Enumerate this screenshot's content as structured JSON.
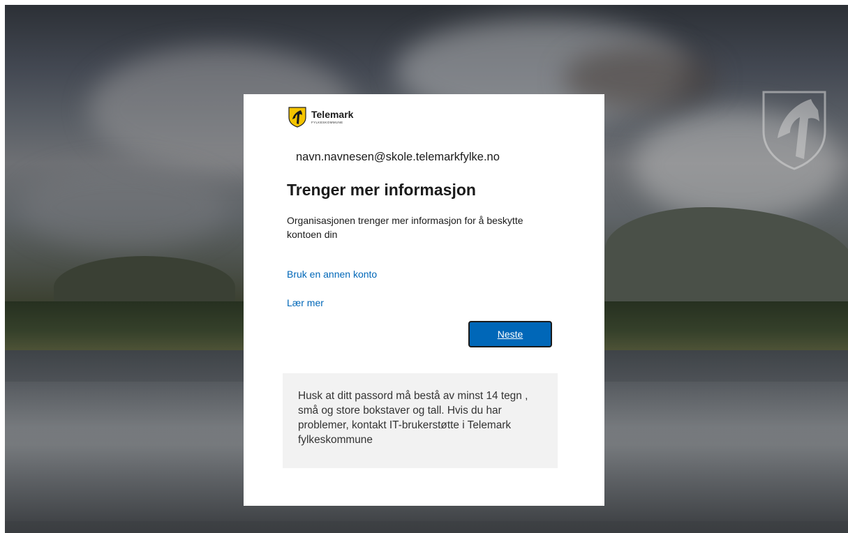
{
  "brand": {
    "name": "Telemark",
    "subtitle": "FYLKESKOMMUNE",
    "emblem_icon": "telemark-coat-of-arms-icon",
    "emblem_color": "#f5c400"
  },
  "background": {
    "crest_icon": "telemark-crest-watermark-icon"
  },
  "dialog": {
    "account": "navn.navnesen@skole.telemarkfylke.no",
    "title": "Trenger mer informasjon",
    "description": "Organisasjonen trenger mer informasjon for å beskytte kontoen din",
    "link_other_account": "Bruk en annen konto",
    "link_learn_more": "Lær mer",
    "next_button": "Neste",
    "info_text": "Husk at ditt passord må bestå av minst 14 tegn , små og store bokstaver og tall. Hvis du har problemer, kontakt IT-brukerstøtte i Telemark fylkeskommune"
  },
  "colors": {
    "link": "#0067b8",
    "primary_button": "#0067b8",
    "info_box_bg": "#f2f2f2"
  }
}
